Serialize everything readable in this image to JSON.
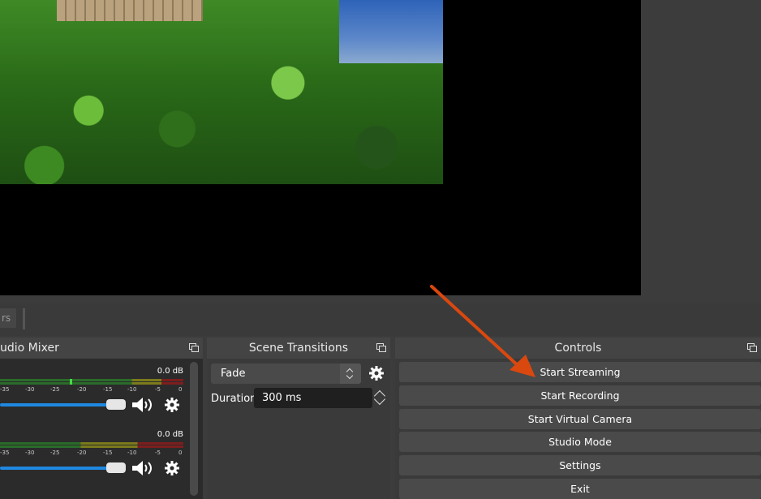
{
  "preview": {
    "toolbar_stub_label": "rs"
  },
  "mixer": {
    "title": "udio Mixer",
    "channels": [
      {
        "db": "0.0 dB",
        "scale": [
          "-35",
          "-30",
          "-25",
          "-20",
          "-15",
          "-10",
          "-5",
          "0"
        ],
        "peak": 0.38,
        "volume": 0.92
      },
      {
        "db": "0.0 dB",
        "scale": [
          "-35",
          "-30",
          "-25",
          "-20",
          "-15",
          "-10",
          "-5",
          "0"
        ],
        "peak": 0,
        "volume": 0.92
      }
    ]
  },
  "transitions": {
    "title": "Scene Transitions",
    "selected": "Fade",
    "duration_label": "Duration",
    "duration_value": "300 ms"
  },
  "controls": {
    "title": "Controls",
    "buttons": [
      "Start Streaming",
      "Start Recording",
      "Start Virtual Camera",
      "Studio Mode",
      "Settings",
      "Exit"
    ]
  },
  "colors": {
    "accent_arrow": "#d9480f",
    "volume_fill": "#1f88e0"
  }
}
